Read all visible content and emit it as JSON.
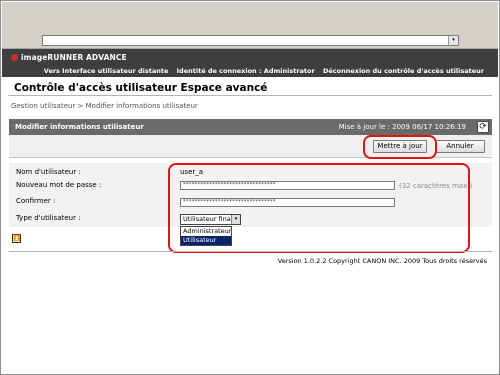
{
  "browser": {
    "address_value": "",
    "dropdown_arrow": "▾"
  },
  "brand": {
    "logo": "canon-logo-icon",
    "name": "imageRUNNER ADVANCE"
  },
  "top_links": [
    "Vers Interface utilisateur distante",
    "Identité de connexion : Administrator",
    "Déconnexion du contrôle d'accès utilisateur"
  ],
  "page_title": "Contrôle d'accès utilisateur Espace avancé",
  "breadcrumb": "Gestion utilisateur > Modifier informations utilisateur",
  "panel": {
    "title": "Modifier informations utilisateur",
    "last_update": "Mise à jour le : 2009 06/17 10:26:19",
    "refresh_icon": "⟳"
  },
  "buttons": {
    "update": "Mettre à jour",
    "cancel": "Annuler"
  },
  "form": {
    "username_label": "Nom d'utilisateur :",
    "username_value": "user_a",
    "new_password_label": "Nouveau mot de passe :",
    "new_password_value": "********************************",
    "password_hint": "(32 caractères max.)",
    "confirm_label": "Confirmer :",
    "confirm_value": "********************************",
    "user_type_label": "Type d'utilisateur :",
    "user_type_selected": "Utilisateur final",
    "user_type_options": [
      "Administrateur",
      "Utilisateur final"
    ]
  },
  "back_to_top_icon": "⏫",
  "footer": "Version 1.0.2.2 Copyright CANON INC. 2009 Tous droits réservés",
  "colors": {
    "banner": "#3e3e3e",
    "highlight": "#e01414",
    "selection": "#0a246a"
  }
}
